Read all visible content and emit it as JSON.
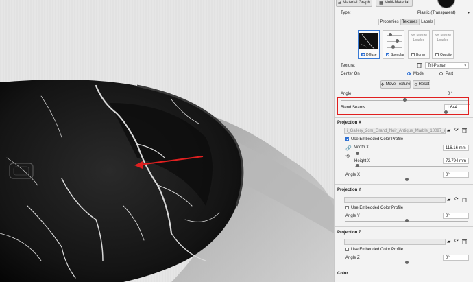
{
  "toolbar": {
    "material_graph": "Material Graph",
    "multi_material": "Multi-Material"
  },
  "type": {
    "label": "Type:",
    "value": "Plastic (Transparent)"
  },
  "tabs": [
    "Properties",
    "Textures",
    "Labels"
  ],
  "texture_slots": [
    {
      "label": "Diffuse",
      "checked": true,
      "status": ""
    },
    {
      "label": "Specular",
      "checked": true,
      "status": ""
    },
    {
      "label": "Bump",
      "checked": false,
      "status": "No Texture Loaded"
    },
    {
      "label": "Opacity",
      "checked": false,
      "status": "No Texture Loaded"
    }
  ],
  "texture": {
    "label": "Texture:",
    "mapping": "Tri-Planar"
  },
  "center_on": {
    "label": "Center On",
    "options": [
      "Model",
      "Part"
    ],
    "selected": "Model"
  },
  "buttons": {
    "move_texture": "Move Texture",
    "reset": "Reset"
  },
  "angle": {
    "label": "Angle",
    "value": "0 °"
  },
  "blend_seams": {
    "label": "Blend Seams",
    "value": "1.644"
  },
  "projection_x": {
    "header": "Projection X",
    "file": "i_Gallery_2cm_Grand_Noir_Antique_Marble_10097_Web.jpg",
    "embedded": "Use Embedded Color Profile",
    "width_label": "Width X",
    "width_value": "116.16 mm",
    "height_label": "Height X",
    "height_value": "72.794 mm",
    "angle_label": "Angle X",
    "angle_value": "0°"
  },
  "projection_y": {
    "header": "Projection Y",
    "embedded": "Use Embedded Color Profile",
    "angle_label": "Angle Y",
    "angle_value": "0°"
  },
  "projection_z": {
    "header": "Projection Z",
    "embedded": "Use Embedded Color Profile",
    "angle_label": "Angle Z",
    "angle_value": "0°"
  },
  "color": {
    "header": "Color"
  },
  "colors": {
    "highlight": "#e02020",
    "arrow": "#e02020",
    "accent": "#2d6fd2"
  }
}
